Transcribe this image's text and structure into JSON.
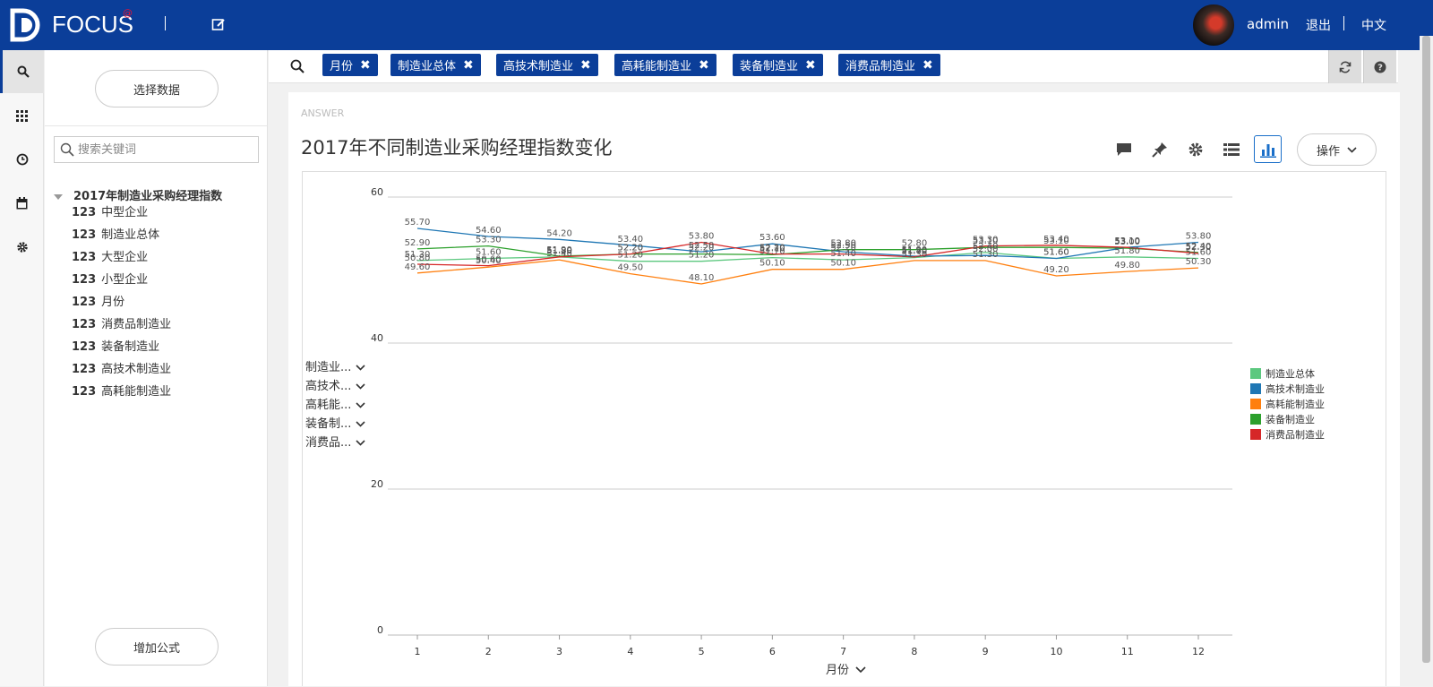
{
  "app": {
    "logo_text": "FOCUS",
    "logo_sup": "@"
  },
  "header": {
    "user": "admin",
    "logout": "退出",
    "language": "中文"
  },
  "sidebar": {
    "select_data": "选择数据",
    "search_placeholder": "搜索关键词",
    "tree_title": "2017年制造业采购经理指数",
    "fields": [
      {
        "type": "123",
        "name": "中型企业"
      },
      {
        "type": "123",
        "name": "制造业总体"
      },
      {
        "type": "123",
        "name": "大型企业"
      },
      {
        "type": "123",
        "name": "小型企业"
      },
      {
        "type": "123",
        "name": "月份"
      },
      {
        "type": "123",
        "name": "消费品制造业"
      },
      {
        "type": "123",
        "name": "装备制造业"
      },
      {
        "type": "123",
        "name": "高技术制造业"
      },
      {
        "type": "123",
        "name": "高耗能制造业"
      }
    ],
    "add_formula": "增加公式"
  },
  "filters": [
    "月份",
    "制造业总体",
    "高技术制造业",
    "高耗能制造业",
    "装备制造业",
    "消费品制造业"
  ],
  "filter_close_glyph": "✖",
  "answer": {
    "label": "ANSWER",
    "title": "2017年不同制造业采购经理指数变化",
    "ops_label": "操作",
    "y_fields": [
      "制造业...",
      "高技术...",
      "高耗能...",
      "装备制...",
      "消费品..."
    ],
    "x_field": "月份"
  },
  "chart_data": {
    "type": "line",
    "x": [
      1,
      2,
      3,
      4,
      5,
      6,
      7,
      8,
      9,
      10,
      11,
      12
    ],
    "ylim": [
      0,
      60
    ],
    "yticks": [
      0,
      20,
      40,
      60
    ],
    "xlabel": "月份",
    "legend_position": "right",
    "series": [
      {
        "name": "制造业总体",
        "color": "#5cc87f",
        "values": [
          51.3,
          51.6,
          51.8,
          51.2,
          51.2,
          51.7,
          51.4,
          51.7,
          52.4,
          51.6,
          51.8,
          51.6
        ]
      },
      {
        "name": "高技术制造业",
        "color": "#1f77b4",
        "values": [
          55.7,
          54.6,
          54.2,
          53.4,
          52.5,
          53.6,
          52.5,
          51.9,
          52.0,
          51.6,
          53.1,
          53.8
        ]
      },
      {
        "name": "高耗能制造业",
        "color": "#ff7f0e",
        "values": [
          49.6,
          50.4,
          51.4,
          49.5,
          48.1,
          50.1,
          50.1,
          51.3,
          51.3,
          49.2,
          49.8,
          50.3
        ]
      },
      {
        "name": "装备制造业",
        "color": "#2ca02c",
        "values": [
          52.9,
          53.3,
          51.9,
          52.2,
          52.2,
          52.1,
          52.8,
          52.8,
          53.1,
          53.1,
          53.0,
          52.4
        ]
      },
      {
        "name": "消费品制造业",
        "color": "#d62728",
        "values": [
          50.8,
          50.6,
          51.8,
          52.2,
          53.8,
          52.2,
          52.2,
          51.8,
          53.3,
          53.4,
          53.1,
          52.3
        ]
      }
    ]
  }
}
